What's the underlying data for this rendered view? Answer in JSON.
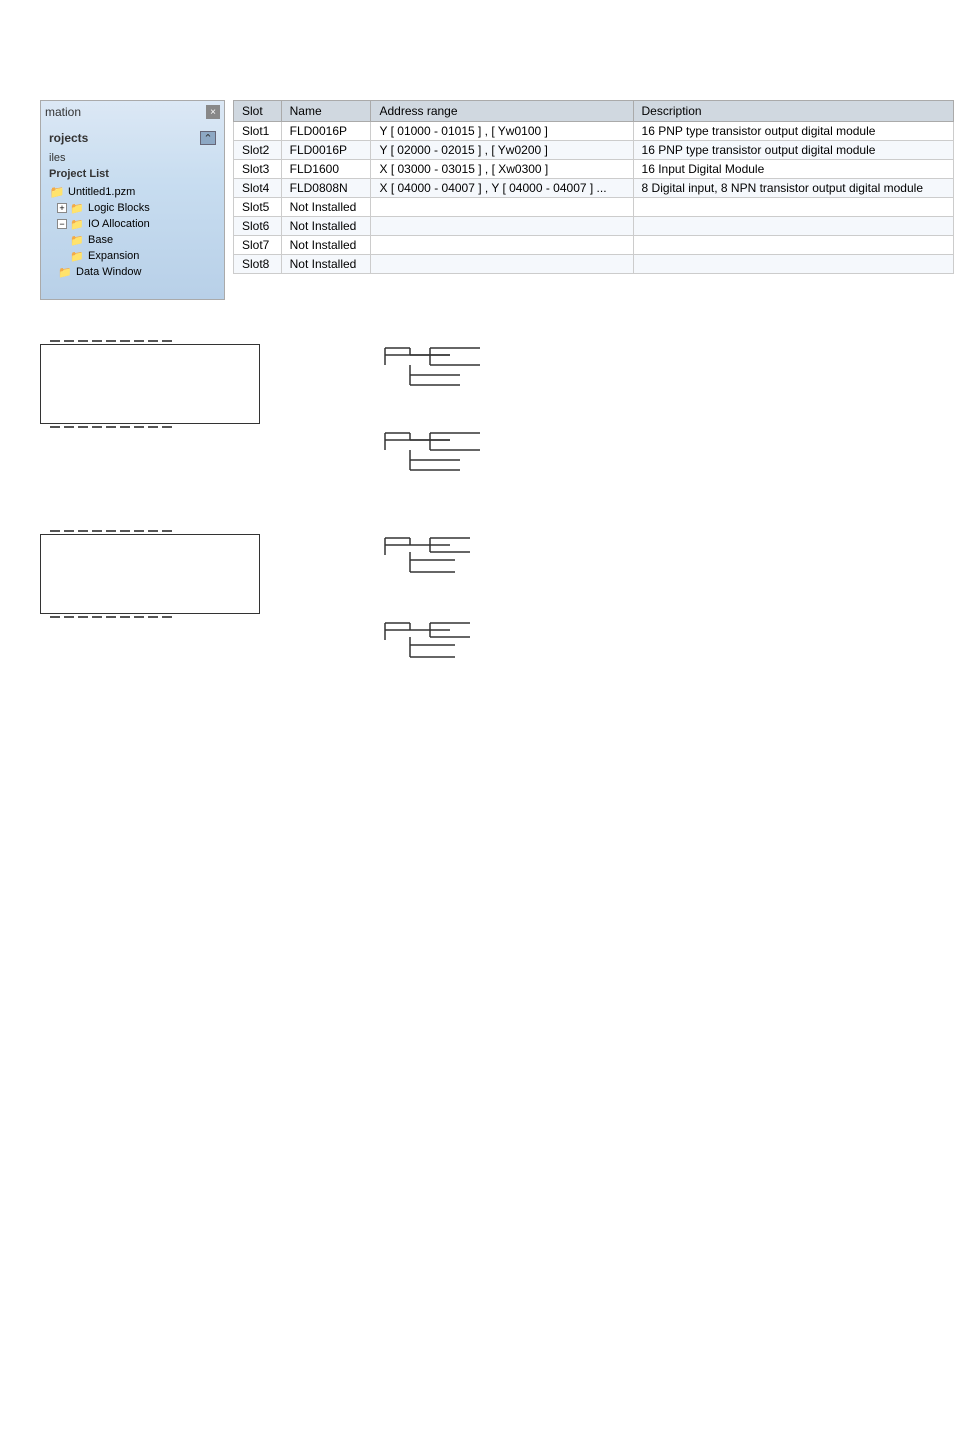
{
  "sidebar": {
    "title": "mation",
    "close_label": "×",
    "projects_label": "rojects",
    "files_label": "iles",
    "project_list_label": "Project List",
    "items": [
      {
        "label": "Untitled1.pzm",
        "type": "project",
        "indent": 0
      },
      {
        "label": "Logic Blocks",
        "type": "folder",
        "indent": 1,
        "expanded": false
      },
      {
        "label": "IO Allocation",
        "type": "folder",
        "indent": 1,
        "expanded": true
      },
      {
        "label": "Base",
        "type": "subfolder",
        "indent": 2
      },
      {
        "label": "Expansion",
        "type": "subfolder",
        "indent": 2
      },
      {
        "label": "Data Window",
        "type": "subfolder",
        "indent": 2
      }
    ]
  },
  "table": {
    "headers": [
      "Slot",
      "Name",
      "Address range",
      "Description"
    ],
    "rows": [
      {
        "slot": "Slot1",
        "name": "FLD0016P",
        "address": "Y [ 01000 - 01015 ] , [ Yw0100 ]",
        "description": "16 PNP type transistor output digital module"
      },
      {
        "slot": "Slot2",
        "name": "FLD0016P",
        "address": "Y [ 02000 - 02015 ] , [ Yw0200 ]",
        "description": "16 PNP type transistor output digital module"
      },
      {
        "slot": "Slot3",
        "name": "FLD1600",
        "address": "X [ 03000 - 03015 ] , [ Xw0300 ]",
        "description": "16 Input Digital Module"
      },
      {
        "slot": "Slot4",
        "name": "FLD0808N",
        "address": "X [ 04000 - 04007 ] , Y [ 04000 - 04007 ] ...",
        "description": "8 Digital input, 8 NPN transistor output digital module"
      },
      {
        "slot": "Slot5",
        "name": "Not Installed",
        "address": "",
        "description": ""
      },
      {
        "slot": "Slot6",
        "name": "Not Installed",
        "address": "",
        "description": ""
      },
      {
        "slot": "Slot7",
        "name": "Not Installed",
        "address": "",
        "description": ""
      },
      {
        "slot": "Slot8",
        "name": "Not Installed",
        "address": "",
        "description": ""
      }
    ]
  },
  "diagrams": {
    "dashes_count": 9,
    "boxes": [
      {
        "id": "box1"
      },
      {
        "id": "box2"
      },
      {
        "id": "box3"
      },
      {
        "id": "box4"
      }
    ]
  }
}
